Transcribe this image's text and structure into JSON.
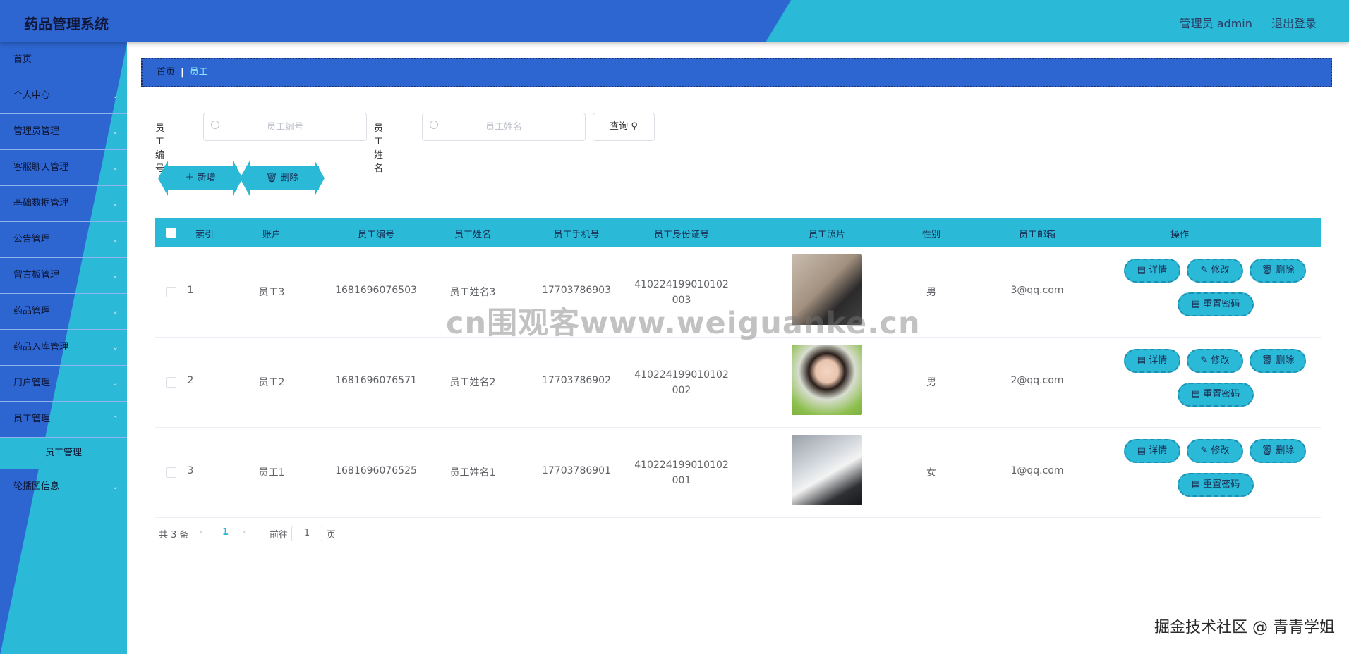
{
  "header": {
    "title": "药品管理系统",
    "user_label": "管理员 admin",
    "logout_label": "退出登录"
  },
  "sidebar": {
    "items": [
      {
        "label": "首页"
      },
      {
        "label": "个人中心"
      },
      {
        "label": "管理员管理"
      },
      {
        "label": "客服聊天管理"
      },
      {
        "label": "基础数据管理"
      },
      {
        "label": "公告管理"
      },
      {
        "label": "留言板管理"
      },
      {
        "label": "药品管理"
      },
      {
        "label": "药品入库管理"
      },
      {
        "label": "用户管理"
      },
      {
        "label": "员工管理"
      },
      {
        "label": "轮播图信息"
      }
    ],
    "active_sub": "员工管理"
  },
  "breadcrumb": {
    "home": "首页",
    "current": "员工"
  },
  "search": {
    "number_label": "员工编号",
    "number_placeholder": "员工编号",
    "name_label": "员工姓名",
    "name_placeholder": "员工姓名",
    "query_label": "查询"
  },
  "actions": {
    "add_label": "新增",
    "delete_label": "删除"
  },
  "table": {
    "headers": [
      "索引",
      "账户",
      "员工编号",
      "员工姓名",
      "员工手机号",
      "员工身份证号",
      "员工照片",
      "性别",
      "员工邮箱",
      "操作"
    ],
    "rows": [
      {
        "index": "1",
        "account": "员工3",
        "number": "1681696076503",
        "name": "员工姓名3",
        "phone": "17703786903",
        "id_line1": "410224199010102",
        "id_line2": "003",
        "gender": "男",
        "email": "3@qq.com"
      },
      {
        "index": "2",
        "account": "员工2",
        "number": "1681696076571",
        "name": "员工姓名2",
        "phone": "17703786902",
        "id_line1": "410224199010102",
        "id_line2": "002",
        "gender": "男",
        "email": "2@qq.com"
      },
      {
        "index": "3",
        "account": "员工1",
        "number": "1681696076525",
        "name": "员工姓名1",
        "phone": "17703786901",
        "id_line1": "410224199010102",
        "id_line2": "001",
        "gender": "女",
        "email": "1@qq.com"
      }
    ],
    "ops": {
      "detail": "详情",
      "edit": "修改",
      "delete": "删除",
      "reset": "重置密码"
    }
  },
  "pagination": {
    "total": "共 3 条",
    "prev": "‹",
    "page": "1",
    "next": "›",
    "goto_label": "前往",
    "goto_value": "1",
    "page_suffix": "页"
  },
  "watermarks": {
    "center": "cn围观客www.weiguanke.cn",
    "corner": "掘金技术社区 @ 青青学姐"
  },
  "colors": {
    "primary_blue": "#2d66d0",
    "accent_cyan": "#2ab9d6"
  }
}
